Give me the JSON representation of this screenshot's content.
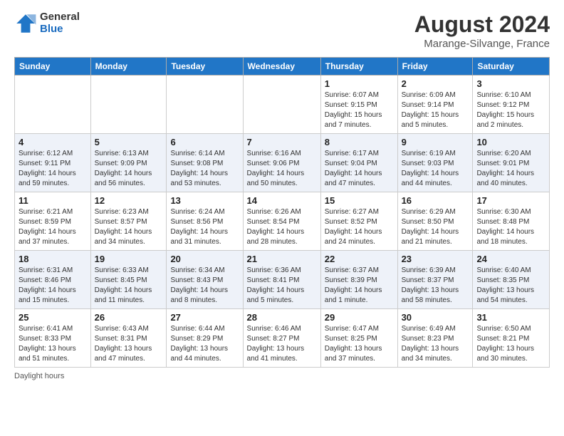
{
  "logo": {
    "general": "General",
    "blue": "Blue"
  },
  "title": "August 2024",
  "location": "Marange-Silvange, France",
  "days_of_week": [
    "Sunday",
    "Monday",
    "Tuesday",
    "Wednesday",
    "Thursday",
    "Friday",
    "Saturday"
  ],
  "footer": "Daylight hours",
  "weeks": [
    [
      {
        "day": "",
        "info": ""
      },
      {
        "day": "",
        "info": ""
      },
      {
        "day": "",
        "info": ""
      },
      {
        "day": "",
        "info": ""
      },
      {
        "day": "1",
        "info": "Sunrise: 6:07 AM\nSunset: 9:15 PM\nDaylight: 15 hours\nand 7 minutes."
      },
      {
        "day": "2",
        "info": "Sunrise: 6:09 AM\nSunset: 9:14 PM\nDaylight: 15 hours\nand 5 minutes."
      },
      {
        "day": "3",
        "info": "Sunrise: 6:10 AM\nSunset: 9:12 PM\nDaylight: 15 hours\nand 2 minutes."
      }
    ],
    [
      {
        "day": "4",
        "info": "Sunrise: 6:12 AM\nSunset: 9:11 PM\nDaylight: 14 hours\nand 59 minutes."
      },
      {
        "day": "5",
        "info": "Sunrise: 6:13 AM\nSunset: 9:09 PM\nDaylight: 14 hours\nand 56 minutes."
      },
      {
        "day": "6",
        "info": "Sunrise: 6:14 AM\nSunset: 9:08 PM\nDaylight: 14 hours\nand 53 minutes."
      },
      {
        "day": "7",
        "info": "Sunrise: 6:16 AM\nSunset: 9:06 PM\nDaylight: 14 hours\nand 50 minutes."
      },
      {
        "day": "8",
        "info": "Sunrise: 6:17 AM\nSunset: 9:04 PM\nDaylight: 14 hours\nand 47 minutes."
      },
      {
        "day": "9",
        "info": "Sunrise: 6:19 AM\nSunset: 9:03 PM\nDaylight: 14 hours\nand 44 minutes."
      },
      {
        "day": "10",
        "info": "Sunrise: 6:20 AM\nSunset: 9:01 PM\nDaylight: 14 hours\nand 40 minutes."
      }
    ],
    [
      {
        "day": "11",
        "info": "Sunrise: 6:21 AM\nSunset: 8:59 PM\nDaylight: 14 hours\nand 37 minutes."
      },
      {
        "day": "12",
        "info": "Sunrise: 6:23 AM\nSunset: 8:57 PM\nDaylight: 14 hours\nand 34 minutes."
      },
      {
        "day": "13",
        "info": "Sunrise: 6:24 AM\nSunset: 8:56 PM\nDaylight: 14 hours\nand 31 minutes."
      },
      {
        "day": "14",
        "info": "Sunrise: 6:26 AM\nSunset: 8:54 PM\nDaylight: 14 hours\nand 28 minutes."
      },
      {
        "day": "15",
        "info": "Sunrise: 6:27 AM\nSunset: 8:52 PM\nDaylight: 14 hours\nand 24 minutes."
      },
      {
        "day": "16",
        "info": "Sunrise: 6:29 AM\nSunset: 8:50 PM\nDaylight: 14 hours\nand 21 minutes."
      },
      {
        "day": "17",
        "info": "Sunrise: 6:30 AM\nSunset: 8:48 PM\nDaylight: 14 hours\nand 18 minutes."
      }
    ],
    [
      {
        "day": "18",
        "info": "Sunrise: 6:31 AM\nSunset: 8:46 PM\nDaylight: 14 hours\nand 15 minutes."
      },
      {
        "day": "19",
        "info": "Sunrise: 6:33 AM\nSunset: 8:45 PM\nDaylight: 14 hours\nand 11 minutes."
      },
      {
        "day": "20",
        "info": "Sunrise: 6:34 AM\nSunset: 8:43 PM\nDaylight: 14 hours\nand 8 minutes."
      },
      {
        "day": "21",
        "info": "Sunrise: 6:36 AM\nSunset: 8:41 PM\nDaylight: 14 hours\nand 5 minutes."
      },
      {
        "day": "22",
        "info": "Sunrise: 6:37 AM\nSunset: 8:39 PM\nDaylight: 14 hours\nand 1 minute."
      },
      {
        "day": "23",
        "info": "Sunrise: 6:39 AM\nSunset: 8:37 PM\nDaylight: 13 hours\nand 58 minutes."
      },
      {
        "day": "24",
        "info": "Sunrise: 6:40 AM\nSunset: 8:35 PM\nDaylight: 13 hours\nand 54 minutes."
      }
    ],
    [
      {
        "day": "25",
        "info": "Sunrise: 6:41 AM\nSunset: 8:33 PM\nDaylight: 13 hours\nand 51 minutes."
      },
      {
        "day": "26",
        "info": "Sunrise: 6:43 AM\nSunset: 8:31 PM\nDaylight: 13 hours\nand 47 minutes."
      },
      {
        "day": "27",
        "info": "Sunrise: 6:44 AM\nSunset: 8:29 PM\nDaylight: 13 hours\nand 44 minutes."
      },
      {
        "day": "28",
        "info": "Sunrise: 6:46 AM\nSunset: 8:27 PM\nDaylight: 13 hours\nand 41 minutes."
      },
      {
        "day": "29",
        "info": "Sunrise: 6:47 AM\nSunset: 8:25 PM\nDaylight: 13 hours\nand 37 minutes."
      },
      {
        "day": "30",
        "info": "Sunrise: 6:49 AM\nSunset: 8:23 PM\nDaylight: 13 hours\nand 34 minutes."
      },
      {
        "day": "31",
        "info": "Sunrise: 6:50 AM\nSunset: 8:21 PM\nDaylight: 13 hours\nand 30 minutes."
      }
    ]
  ]
}
